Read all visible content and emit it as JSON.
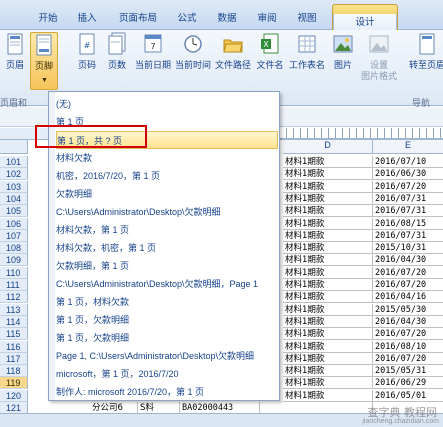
{
  "tabs": [
    "开始",
    "插入",
    "页面布局",
    "公式",
    "数据",
    "审阅",
    "视图",
    "设计"
  ],
  "ribbon": {
    "buttons": [
      "页眉",
      "页脚",
      "页码",
      "页数",
      "当前日期",
      "当前时间",
      "文件路径",
      "文件名",
      "工作表名",
      "图片",
      "设置\n图片格式",
      "转至页眉"
    ],
    "group_label_left": "页眉和",
    "group_label_right": "导航"
  },
  "columns": {
    "d": "D",
    "e": "E"
  },
  "dropdown": {
    "items": [
      "(无)",
      "第 1 页",
      "第 1 页，共 ? 页",
      "材料欠款",
      " 机密，2016/7/20，第 1 页",
      "欠款明细",
      "C:\\Users\\Administrator\\Desktop\\欠款明细",
      "材料欠款，第 1 页",
      "材料欠款，机密，第 1 页",
      "欠款明细，第 1 页",
      "C:\\Users\\Administrator\\Desktop\\欠款明细，Page 1",
      "第 1 页，材料欠款",
      "第 1 页，欠款明细",
      "第 1 页，欠款明细",
      "Page 1, C:\\Users\\Administrator\\Desktop\\欠款明细",
      "microsoft，第 1 页，2016/7/20",
      "制作人: microsoft 2016/7/20，第 1 页"
    ],
    "hover_index": 2
  },
  "rows": [
    {
      "n": "101",
      "d": "材料1期款",
      "e": "2016/07/10"
    },
    {
      "n": "102",
      "d": "材料1期款",
      "e": "2016/06/30"
    },
    {
      "n": "103",
      "d": "材料1期款",
      "e": "2016/07/20"
    },
    {
      "n": "104",
      "d": "材料1期款",
      "e": "2016/07/31"
    },
    {
      "n": "105",
      "d": "材料1期款",
      "e": "2016/07/31"
    },
    {
      "n": "106",
      "d": "材料1期款",
      "e": "2016/08/15"
    },
    {
      "n": "107",
      "d": "材料1期款",
      "e": "2016/07/31"
    },
    {
      "n": "108",
      "d": "材料1期款",
      "e": "2015/10/31"
    },
    {
      "n": "109",
      "d": "材料1期款",
      "e": "2016/04/30"
    },
    {
      "n": "110",
      "d": "材料1期款",
      "e": "2016/07/20"
    },
    {
      "n": "111",
      "d": "材料1期款",
      "e": "2016/07/20"
    },
    {
      "n": "112",
      "d": "材料1期款",
      "e": "2016/04/16"
    },
    {
      "n": "113",
      "d": "材料1期款",
      "e": "2015/05/30"
    },
    {
      "n": "114",
      "d": "材料1期款",
      "e": "2016/04/30"
    },
    {
      "n": "115",
      "d": "材料1期款",
      "e": "2016/07/20"
    },
    {
      "n": "116",
      "d": "材料1期款",
      "e": "2016/08/10"
    },
    {
      "n": "117",
      "d": "材料1期款",
      "e": "2016/07/20"
    },
    {
      "n": "118",
      "d": "材料1期款",
      "e": "2015/05/31"
    },
    {
      "n": "119",
      "d": "材料1期款",
      "e": "2016/06/29"
    },
    {
      "n": "120",
      "d": "材料1期款",
      "e": "2016/05/01"
    },
    {
      "n": "121",
      "d": "",
      "e": ""
    }
  ],
  "highlight_row": "119",
  "last_row_cells": [
    "分公司6",
    "S料",
    "BA02000443"
  ],
  "watermark": "查字典 教程网",
  "watermark_url": "jiaocheng.chazidian.com"
}
